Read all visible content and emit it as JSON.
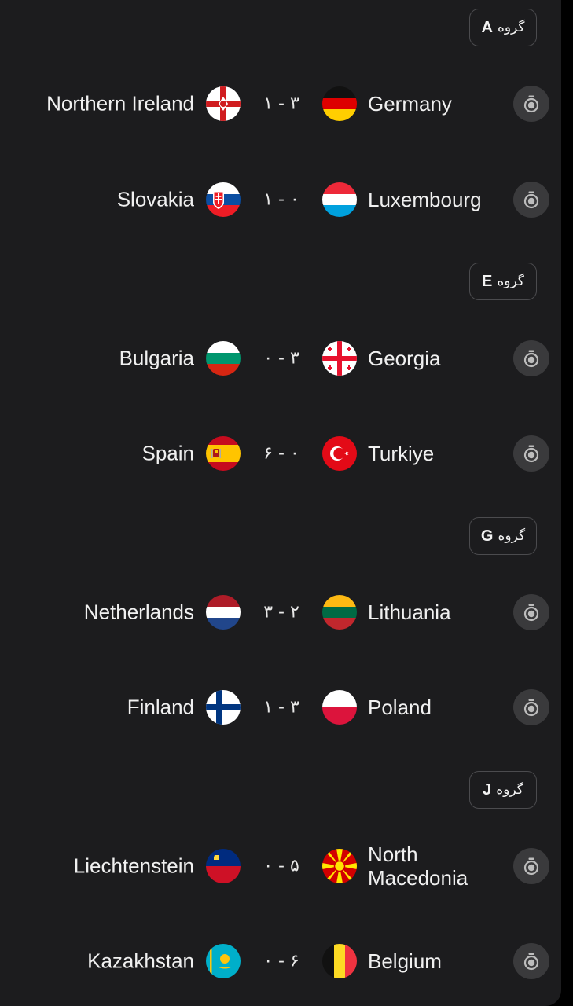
{
  "groups": [
    {
      "word": "گروه",
      "letter": "A"
    },
    {
      "word": "گروه",
      "letter": "E"
    },
    {
      "word": "گروه",
      "letter": "G"
    },
    {
      "word": "گروه",
      "letter": "J"
    }
  ],
  "matches": [
    {
      "home": "Northern Ireland",
      "away": "Germany",
      "score": "۱ - ۳",
      "home_flag": "northern-ireland-flag",
      "away_flag": "germany-flag"
    },
    {
      "home": "Slovakia",
      "away": "Luxembourg",
      "score": "۱ - ۰",
      "home_flag": "slovakia-flag",
      "away_flag": "luxembourg-flag"
    },
    {
      "home": "Bulgaria",
      "away": "Georgia",
      "score": "۰ - ۳",
      "home_flag": "bulgaria-flag",
      "away_flag": "georgia-flag"
    },
    {
      "home": "Spain",
      "away": "Turkiye",
      "score": "۶ - ۰",
      "home_flag": "spain-flag",
      "away_flag": "turkiye-flag"
    },
    {
      "home": "Netherlands",
      "away": "Lithuania",
      "score": "۳ - ۲",
      "home_flag": "netherlands-flag",
      "away_flag": "lithuania-flag"
    },
    {
      "home": "Finland",
      "away": "Poland",
      "score": "۱ - ۳",
      "home_flag": "finland-flag",
      "away_flag": "poland-flag"
    },
    {
      "home": "Liechtenstein",
      "away": "North Macedonia",
      "score": "۰ - ۵",
      "home_flag": "liechtenstein-flag",
      "away_flag": "north-macedonia-flag"
    },
    {
      "home": "Kazakhstan",
      "away": "Belgium",
      "score": "۰ - ۶",
      "home_flag": "kazakhstan-flag",
      "away_flag": "belgium-flag"
    }
  ],
  "icons": {
    "watch": "stopwatch-icon"
  },
  "colors": {
    "background": "#1c1c1e",
    "button": "#3a3a3c",
    "text": "#f0f0f0",
    "badge_border": "#4b4b4e"
  }
}
